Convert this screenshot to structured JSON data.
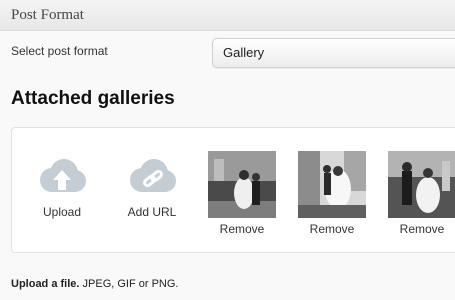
{
  "panel": {
    "title": "Post Format"
  },
  "format_field": {
    "label": "Select post format",
    "value": "Gallery"
  },
  "galleries": {
    "title": "Attached galleries",
    "actions": [
      {
        "label": "Upload",
        "icon": "cloud-upload-icon"
      },
      {
        "label": "Add URL",
        "icon": "cloud-link-icon"
      }
    ],
    "images": [
      {
        "remove_label": "Remove"
      },
      {
        "remove_label": "Remove"
      },
      {
        "remove_label": "Remove"
      }
    ]
  },
  "hint": {
    "strong": "Upload a file.",
    "text": " JPEG, GIF or PNG."
  },
  "colors": {
    "icon": "#c4ccd4",
    "header_bg": "#eeeeee",
    "box_border": "#e1e1e1"
  }
}
